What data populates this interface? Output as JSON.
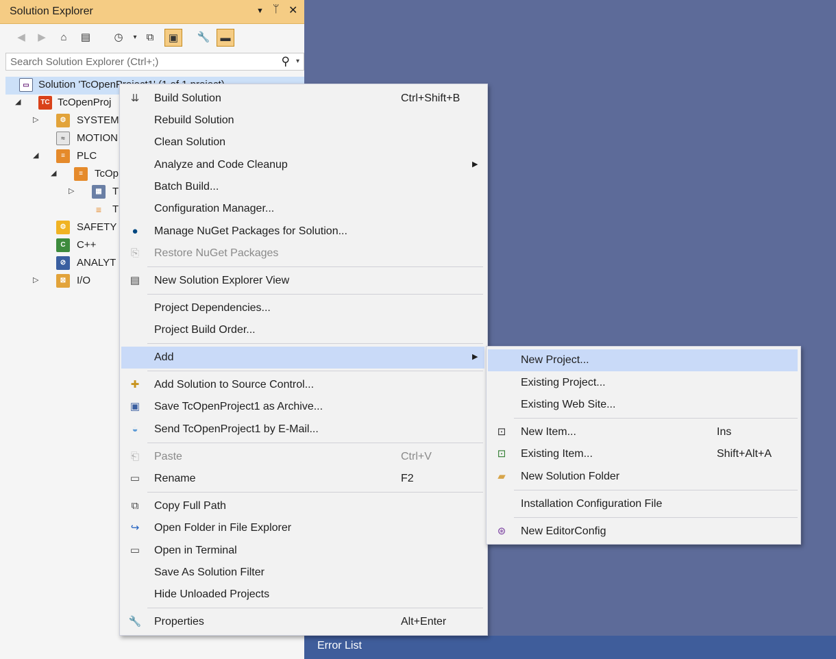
{
  "solution_explorer": {
    "title": "Solution Explorer",
    "search_placeholder": "Search Solution Explorer (Ctrl+;)",
    "tree": [
      {
        "label": "Solution 'TcOpenProject1' (1 of 1 project)",
        "icon": "solution-icon"
      },
      {
        "label": "TcOpenProj",
        "icon": "twincat-project-icon"
      },
      {
        "label": "SYSTEM",
        "icon": "system-icon"
      },
      {
        "label": "MOTION",
        "icon": "motion-icon"
      },
      {
        "label": "PLC",
        "icon": "plc-icon"
      },
      {
        "label": "TcOp",
        "icon": "plc-project-icon"
      },
      {
        "label": "T",
        "icon": "plc-subitem-icon"
      },
      {
        "label": "T",
        "icon": "plc-instance-icon"
      },
      {
        "label": "SAFETY",
        "icon": "safety-icon"
      },
      {
        "label": "C++",
        "icon": "cpp-icon"
      },
      {
        "label": "ANALYT",
        "icon": "analytics-icon"
      },
      {
        "label": "I/O",
        "icon": "io-icon"
      }
    ]
  },
  "context_menu": {
    "items": [
      {
        "label": "Build Solution",
        "shortcut": "Ctrl+Shift+B",
        "icon": "build-icon"
      },
      {
        "label": "Rebuild Solution"
      },
      {
        "label": "Clean Solution"
      },
      {
        "label": "Analyze and Code Cleanup"
      },
      {
        "label": "Batch Build..."
      },
      {
        "label": "Configuration Manager..."
      },
      {
        "label": "Manage NuGet Packages for Solution...",
        "icon": "nuget-icon"
      },
      {
        "label": "Restore NuGet Packages",
        "icon": "restore-icon"
      },
      {
        "label": "New Solution Explorer View",
        "icon": "new-view-icon"
      },
      {
        "label": "Project Dependencies..."
      },
      {
        "label": "Project Build Order..."
      },
      {
        "label": "Add"
      },
      {
        "label": "Add Solution to Source Control...",
        "icon": "source-control-icon"
      },
      {
        "label": "Save TcOpenProject1 as Archive...",
        "icon": "archive-icon"
      },
      {
        "label": "Send TcOpenProject1 by E-Mail...",
        "icon": "email-icon"
      },
      {
        "label": "Paste",
        "shortcut": "Ctrl+V",
        "icon": "paste-icon"
      },
      {
        "label": "Rename",
        "shortcut": "F2",
        "icon": "rename-icon"
      },
      {
        "label": "Copy Full Path",
        "icon": "copy-icon"
      },
      {
        "label": "Open Folder in File Explorer",
        "icon": "open-folder-icon"
      },
      {
        "label": "Open in Terminal",
        "icon": "terminal-icon"
      },
      {
        "label": "Save As Solution Filter"
      },
      {
        "label": "Hide Unloaded Projects"
      },
      {
        "label": "Properties",
        "shortcut": "Alt+Enter",
        "icon": "wrench-icon"
      }
    ]
  },
  "add_submenu": {
    "items": [
      {
        "label": "New Project..."
      },
      {
        "label": "Existing Project..."
      },
      {
        "label": "Existing Web Site..."
      },
      {
        "label": "New Item...",
        "shortcut": "Ins",
        "icon": "new-item-icon"
      },
      {
        "label": "Existing Item...",
        "shortcut": "Shift+Alt+A",
        "icon": "existing-item-icon"
      },
      {
        "label": "New Solution Folder",
        "icon": "folder-icon"
      },
      {
        "label": "Installation Configuration File"
      },
      {
        "label": "New EditorConfig",
        "icon": "editorconfig-icon"
      }
    ]
  },
  "error_list": {
    "title": "Error List"
  },
  "colors": {
    "accent": "#f5cc84",
    "highlight": "#c9daf8",
    "background": "#5d6b99"
  }
}
